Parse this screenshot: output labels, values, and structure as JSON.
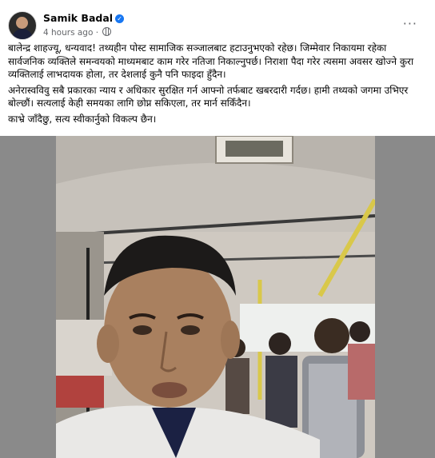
{
  "post": {
    "author": "Samik Badal",
    "timestamp": "4 hours ago",
    "more_label": "···",
    "paragraphs": [
      "बालेन्द्र शाहज्यू, धन्यवाद! तथ्यहीन पोस्ट सामाजिक सञ्जालबाट हटाउनुभएको रहेछ। जिम्मेवार निकायमा रहेका सार्वजनिक व्यक्तिले समन्वयको माध्यमबाट काम गरेर नतिजा निकाल्नुपर्छ। निराशा पैदा गरेर त्यसमा अवसर खोज्ने कुरा व्यक्तिलाई लाभदायक होला, तर देशलाई कुनै पनि फाइदा हुँदैन।",
      "अनेरास्वविवु सबै प्रकारका न्याय र अधिकार सुरक्षित गर्न आफ्नो तर्फबाट खबरदारी गर्दछ। हामी तथ्यको जगमा उभिएर बोल्छौं। सत्यलाई केही समयका लागि छोप्न सकिएला, तर मार्न सकिँदैन।",
      "काभ्रे जाँदैछु, सत्य स्वीकार्नुको विकल्प छैन।"
    ]
  },
  "colors": {
    "verified": "#1877f2",
    "meta_text": "#65676b"
  }
}
